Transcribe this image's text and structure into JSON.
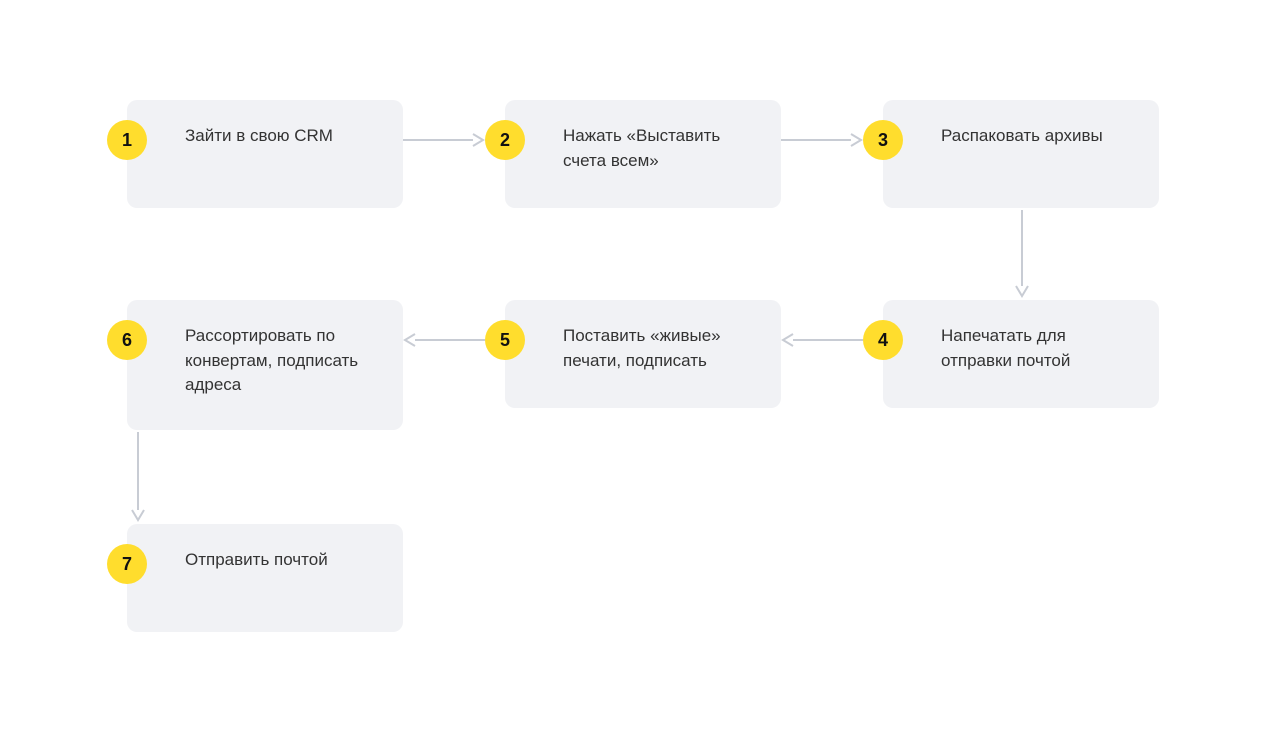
{
  "colors": {
    "card_bg": "#f1f2f5",
    "badge_bg": "#ffdd2d",
    "arrow": "#c8ccd4",
    "text": "#333333"
  },
  "steps": [
    {
      "num": "1",
      "text": "Зайти в свою CRM"
    },
    {
      "num": "2",
      "text": "Нажать «Выставить счета всем»"
    },
    {
      "num": "3",
      "text": "Распаковать архивы"
    },
    {
      "num": "4",
      "text": "Напечатать для отправки почтой"
    },
    {
      "num": "5",
      "text": "Поставить «живые» печати, подписать"
    },
    {
      "num": "6",
      "text": "Рассортировать по конвертам, подписать адреса"
    },
    {
      "num": "7",
      "text": "Отправить почтой"
    }
  ],
  "flow": [
    "1→2",
    "2→3",
    "3→4",
    "4→5",
    "5→6",
    "6→7"
  ]
}
